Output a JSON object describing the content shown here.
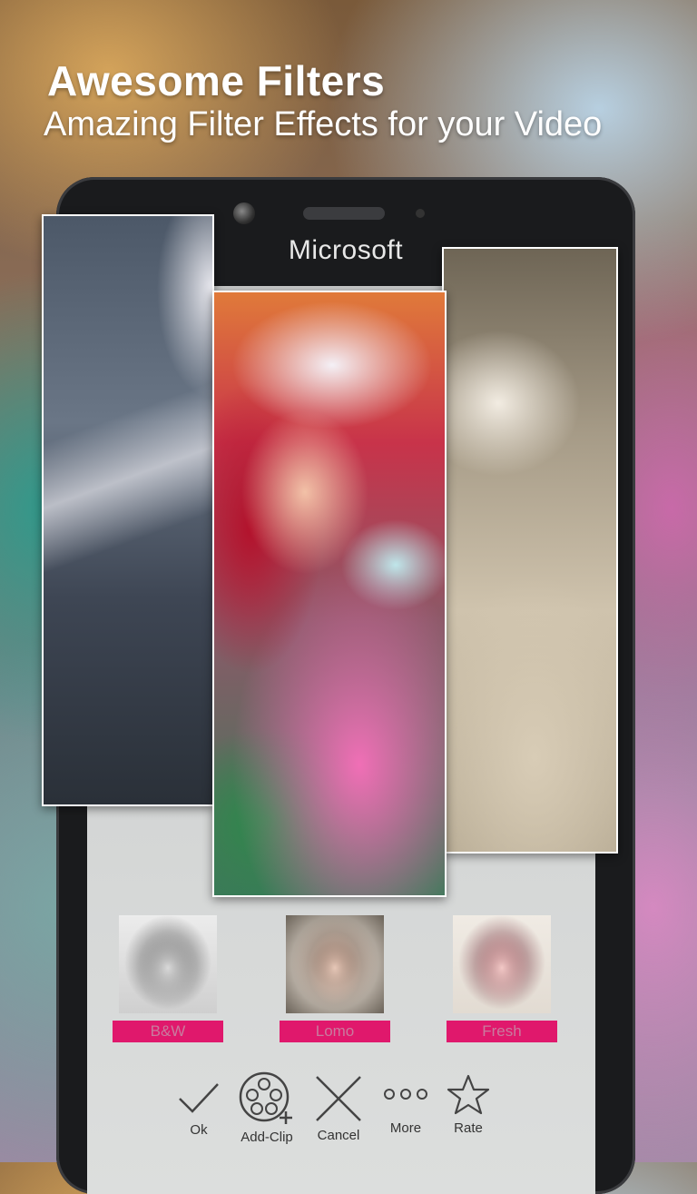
{
  "header": {
    "title": "Awesome Filters",
    "subtitle": "Amazing Filter Effects for your Video"
  },
  "device": {
    "brand": "Microsoft"
  },
  "filters": [
    {
      "label": "B&W"
    },
    {
      "label": "Lomo"
    },
    {
      "label": "Fresh"
    }
  ],
  "toolbar": {
    "ok": "Ok",
    "add_clip": "Add-Clip",
    "cancel": "Cancel",
    "more": "More",
    "rate": "Rate"
  },
  "colors": {
    "filter_label_bg": "#e0186c"
  }
}
